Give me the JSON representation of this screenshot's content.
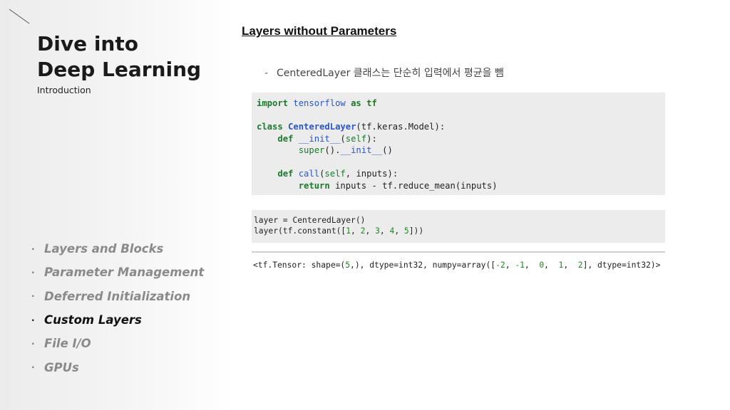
{
  "sidebar": {
    "title_line1": "Dive into",
    "title_line2": "Deep Learning",
    "subtitle": "Introduction",
    "bullet_char": "·",
    "nav": [
      {
        "label": "Layers and Blocks"
      },
      {
        "label": "Parameter Management"
      },
      {
        "label": "Deferred Initialization"
      },
      {
        "label": "Custom Layers",
        "active": true
      },
      {
        "label": "File I/O"
      },
      {
        "label": "GPUs"
      }
    ]
  },
  "main": {
    "section_title": "Layers without Parameters",
    "bullet": {
      "dash": "-",
      "text": "CenteredLayer 클래스는 단순히 입력에서 평균을 뺌"
    },
    "code_block_1": {
      "line1": {
        "kw_import": "import",
        "module": "tensorflow",
        "kw_as": "as",
        "alias": "tf"
      },
      "line3": {
        "kw_class": "class",
        "class_name": "CenteredLayer",
        "rest": "(tf.keras.Model):"
      },
      "line4": {
        "kw_def": "def",
        "method": "__init__",
        "open": "(",
        "self": "self",
        "close": "):"
      },
      "line5": {
        "super": "super",
        "mid": "().",
        "init": "__init__",
        "end": "()"
      },
      "line7": {
        "kw_def": "def",
        "method": "call",
        "open": "(",
        "self": "self",
        "rest": ", inputs):"
      },
      "line8": {
        "kw_return": "return",
        "rest": "inputs - tf.reduce_mean(inputs)"
      }
    },
    "code_block_2": {
      "line1": "layer = CenteredLayer()",
      "line2": {
        "prefix": "layer(tf.constant([",
        "n1": "1",
        "n2": "2",
        "n3": "3",
        "n4": "4",
        "n5": "5",
        "sep": ", ",
        "suffix": "]))"
      }
    },
    "output": {
      "prefix": "<tf.Tensor: shape=(",
      "shape_num": "5",
      "mid": ",), dtype=int32, numpy=array([",
      "v1": "-2",
      "v2": "-1",
      "v3": "0",
      "v4": "1",
      "v5": "2",
      "s1": ", ",
      "s2": ",  ",
      "s3": ",  ",
      "s4": ",  ",
      "suffix": "], dtype=int32)>"
    }
  },
  "colors": {
    "keyword": "#1b7a2d",
    "function_name": "#2a56c6",
    "number": "#1a8a1a",
    "code_background": "#ececec",
    "nav_inactive": "#8a8a8a",
    "nav_active": "#111111"
  }
}
